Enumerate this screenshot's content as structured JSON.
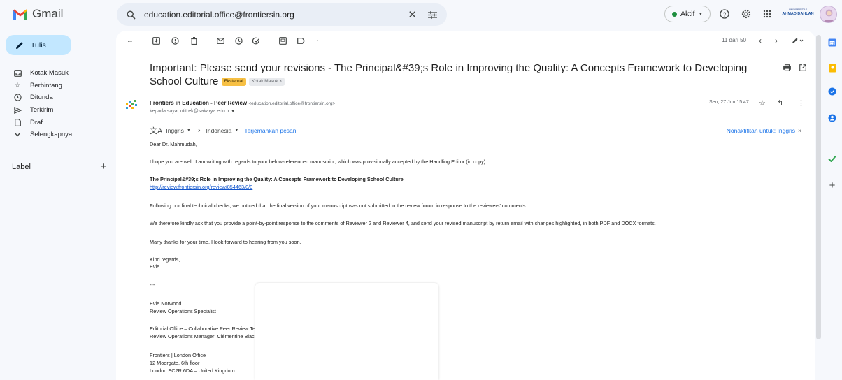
{
  "app": {
    "name": "Gmail"
  },
  "search": {
    "value": "education.editorial.office@frontiersin.org"
  },
  "status": {
    "label": "Aktif"
  },
  "org_logo": {
    "line1": "UNIVERSITAS",
    "line2": "AHMAD DAHLAN"
  },
  "sidebar": {
    "compose_label": "Tulis",
    "items": [
      {
        "label": "Kotak Masuk",
        "icon": "inbox-icon"
      },
      {
        "label": "Berbintang",
        "icon": "star-icon"
      },
      {
        "label": "Ditunda",
        "icon": "clock-icon"
      },
      {
        "label": "Terkirim",
        "icon": "send-icon"
      },
      {
        "label": "Draf",
        "icon": "draft-icon"
      },
      {
        "label": "Selengkapnya",
        "icon": "chevron-down-icon"
      }
    ],
    "label_heading": "Label"
  },
  "toolbar": {
    "pager": "11 dari 50"
  },
  "email": {
    "subject": "Important: Please send your revisions - The Principal&#39;s Role in Improving the Quality: A Concepts Framework to Developing School Culture",
    "badge_external": "Eksternal",
    "badge_inbox": "Kotak Masuk",
    "sender_name": "Frontiers in Education - Peer Review",
    "sender_email": "<education.editorial.office@frontiersin.org>",
    "recipients": "kepada saya, otitrek@sakarya.edu.tr",
    "date": "Sen, 27 Jun 15.47",
    "translate": {
      "from_lang": "Inggris",
      "to_lang": "Indonesia",
      "translate_link": "Terjemahkan pesan",
      "disable_link": "Nonaktifkan untuk: Inggris"
    },
    "body": {
      "greeting": "Dear Dr. Mahmudah,",
      "p1": "I hope you are well. I am writing with regards to your below-referenced manuscript, which was provisionally accepted by the Handling Editor (in copy):",
      "ms_title": "The Principal&#39;s Role in Improving the Quality: A Concepts Framework to Developing School Culture",
      "ms_link": "http://review.frontiersin.org/review/854463/0/0",
      "p2": "Following our final technical checks, we noticed that the final version of your manuscript was not submitted in the review forum in response to the reviewers' comments.",
      "p3": "We therefore kindly ask that you provide a point-by-point response to the comments of Reviewer 2 and Reviewer 4, and send your revised manuscript by return email with changes highlighted, in both PDF and DOCX formats.",
      "p4": "Many thanks for your time, I look forward to hearing from you soon.",
      "closing": "Kind regards,",
      "closing_name": "Evie",
      "sep": "---",
      "sig_name": "Evie Norwood",
      "sig_title": "Review Operations Specialist",
      "team": "Editorial Office – Collaborative Peer Review Team",
      "manager": "Review Operations Manager: Clémentine Blachère",
      "office": "Frontiers | London Office",
      "addr1": "12 Moorgate, 6th floor",
      "addr2": "London EC2R 6DA – United Kingdom"
    }
  },
  "colors": {
    "compose_bg": "#c2e7ff",
    "external_badge": "#f7c044",
    "link": "#1155cc",
    "active_dot": "#1e8e3e"
  }
}
